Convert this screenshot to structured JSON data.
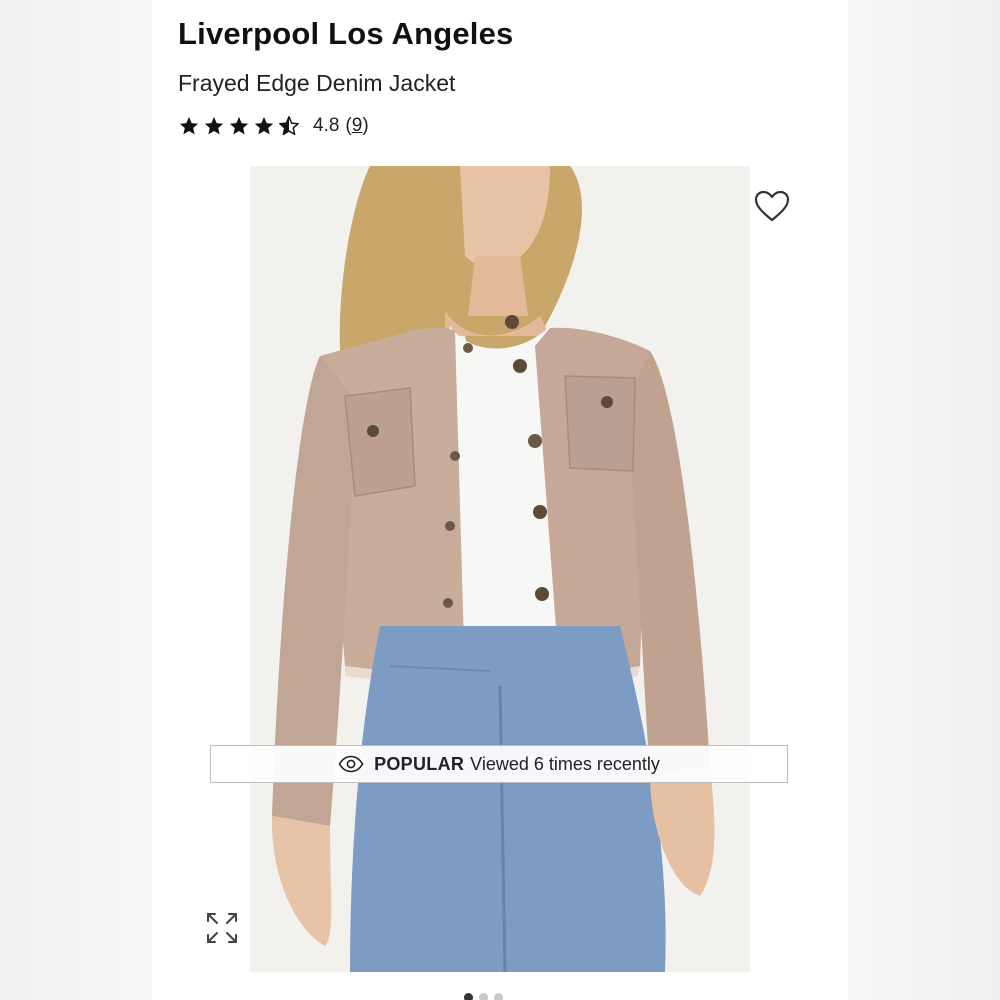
{
  "product": {
    "brand": "Liverpool Los Angeles",
    "name": "Frayed Edge Denim Jacket"
  },
  "rating": {
    "value": "4.8",
    "stars": 4.5,
    "count_open": "(",
    "count": "9",
    "count_close": ")"
  },
  "image": {
    "jacket_color": "#c8ad9b",
    "jeans_color": "#7c9cc4",
    "background_color": "#f3f1ee"
  },
  "popular_banner": {
    "label": "POPULAR",
    "text": "Viewed 6 times recently"
  },
  "icons": {
    "favorite": "heart-outline-icon",
    "popular": "eye-icon",
    "expand": "expand-icon"
  },
  "carousel": {
    "total": 3,
    "active_index": 0
  }
}
